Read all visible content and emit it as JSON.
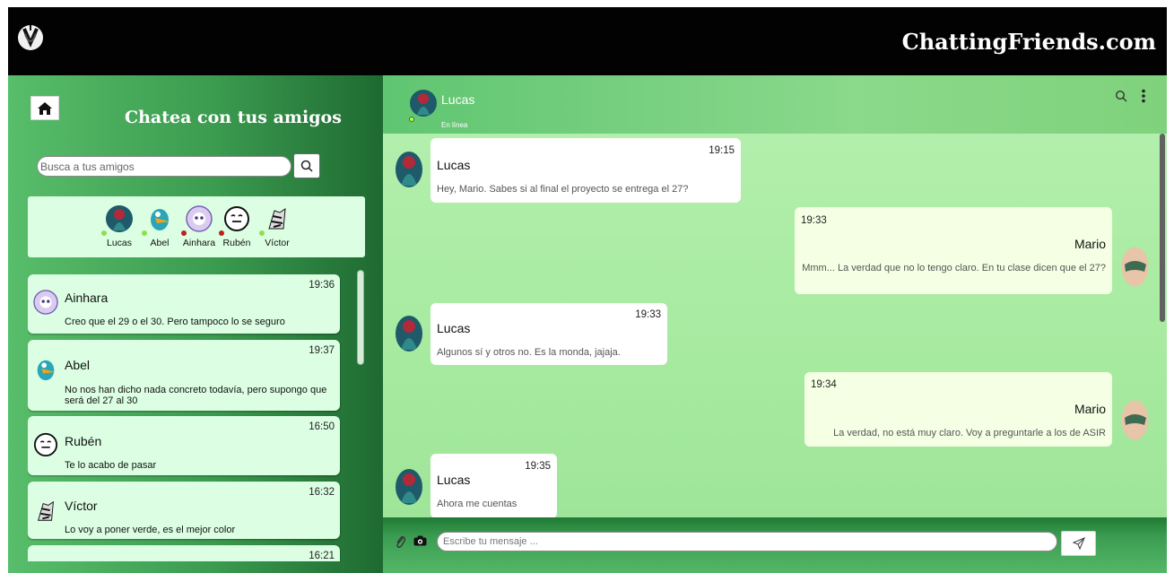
{
  "app": {
    "brand": "ChattingFriends.com",
    "logo_icon": "heart-leaf-logo"
  },
  "sidebar": {
    "title": "Chatea con tus amigos",
    "home_icon": "home-icon",
    "search": {
      "placeholder": "Busca a tus amigos",
      "value": "",
      "button_icon": "search-icon"
    },
    "friends": [
      {
        "name": "Lucas",
        "status": "online",
        "status_color": "#8ee04a",
        "avatar": "lucas-avatar"
      },
      {
        "name": "Abel",
        "status": "online",
        "status_color": "#8ee04a",
        "avatar": "abel-avatar"
      },
      {
        "name": "Ainhara",
        "status": "busy",
        "status_color": "#c0201b",
        "avatar": "ainhara-avatar"
      },
      {
        "name": "Rubén",
        "status": "busy",
        "status_color": "#c0201b",
        "avatar": "ruben-avatar"
      },
      {
        "name": "Víctor",
        "status": "online",
        "status_color": "#8ee04a",
        "avatar": "victor-avatar"
      }
    ],
    "chats": [
      {
        "name": "Ainhara",
        "time": "19:36",
        "message": "Creo que el 29 o el 30. Pero tampoco lo se seguro"
      },
      {
        "name": "Abel",
        "time": "19:37",
        "message": "No nos han dicho nada concreto todavía, pero supongo que será del 27 al 30"
      },
      {
        "name": "Rubén",
        "time": "16:50",
        "message": "Te lo acabo de pasar"
      },
      {
        "name": "Víctor",
        "time": "16:32",
        "message": "Lo voy a poner verde, es el mejor color"
      },
      {
        "name": "",
        "time": "16:21",
        "message": ""
      }
    ]
  },
  "chat": {
    "contact": {
      "name": "Lucas",
      "status": "En línea",
      "status_color": "#b6ff3d"
    },
    "header_icons": [
      "search-icon",
      "more-vertical-icon"
    ],
    "messages": [
      {
        "direction": "in",
        "author": "Lucas",
        "time": "19:15",
        "text": "Hey, Mario. Sabes si al final el proyecto se entrega el 27?"
      },
      {
        "direction": "out",
        "author": "Mario",
        "time": "19:33",
        "text": "Mmm... La verdad que no lo tengo claro. En tu clase dicen que el 27?"
      },
      {
        "direction": "in",
        "author": "Lucas",
        "time": "19:33",
        "text": "Algunos sí y otros no. Es la monda, jajaja."
      },
      {
        "direction": "out",
        "author": "Mario",
        "time": "19:34",
        "text": "La verdad, no está muy claro. Voy a preguntarle a los de ASIR"
      },
      {
        "direction": "in",
        "author": "Lucas",
        "time": "19:35",
        "text": "Ahora me cuentas"
      }
    ],
    "composer": {
      "placeholder": "Escribe tu mensaje ...",
      "value": "",
      "attach_icon": "paperclip-icon",
      "camera_icon": "camera-icon",
      "send_icon": "send-icon"
    }
  },
  "colors": {
    "topbar": "#020202",
    "card": "#dcffe3",
    "chat_bg": "#a9eaa2",
    "bubble_in": "#ffffff",
    "bubble_out": "#f4ffe4"
  }
}
